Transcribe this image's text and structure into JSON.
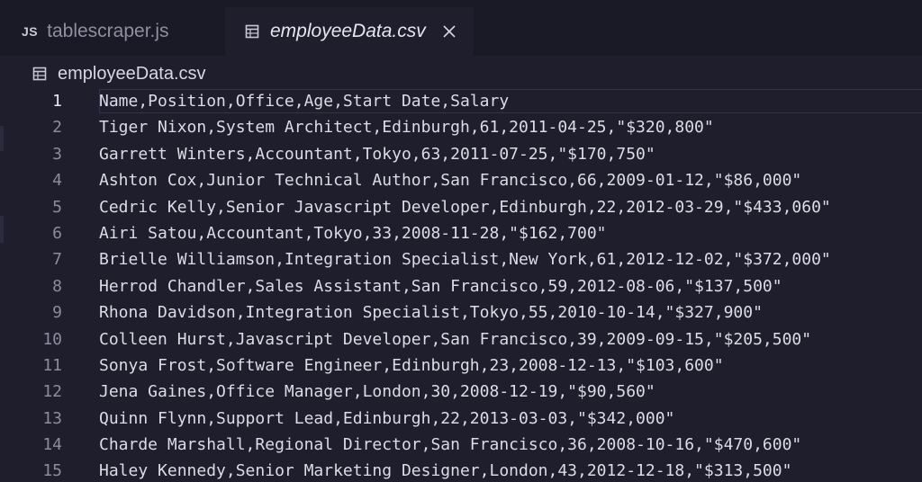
{
  "tabs": [
    {
      "icon": "JS",
      "label": "tablescraper.js",
      "active": false
    },
    {
      "icon": "csv-file-icon",
      "label": "employeeData.csv",
      "active": true
    }
  ],
  "breadcrumb": {
    "icon": "csv-file-icon",
    "label": "employeeData.csv"
  },
  "editor": {
    "current_line": 1,
    "lines": [
      {
        "number": "1",
        "text": "Name,Position,Office,Age,Start Date,Salary"
      },
      {
        "number": "2",
        "text": "Tiger Nixon,System Architect,Edinburgh,61,2011-04-25,\"$320,800\""
      },
      {
        "number": "3",
        "text": "Garrett Winters,Accountant,Tokyo,63,2011-07-25,\"$170,750\""
      },
      {
        "number": "4",
        "text": "Ashton Cox,Junior Technical Author,San Francisco,66,2009-01-12,\"$86,000\""
      },
      {
        "number": "5",
        "text": "Cedric Kelly,Senior Javascript Developer,Edinburgh,22,2012-03-29,\"$433,060\""
      },
      {
        "number": "6",
        "text": "Airi Satou,Accountant,Tokyo,33,2008-11-28,\"$162,700\""
      },
      {
        "number": "7",
        "text": "Brielle Williamson,Integration Specialist,New York,61,2012-12-02,\"$372,000\""
      },
      {
        "number": "8",
        "text": "Herrod Chandler,Sales Assistant,San Francisco,59,2012-08-06,\"$137,500\""
      },
      {
        "number": "9",
        "text": "Rhona Davidson,Integration Specialist,Tokyo,55,2010-10-14,\"$327,900\""
      },
      {
        "number": "10",
        "text": "Colleen Hurst,Javascript Developer,San Francisco,39,2009-09-15,\"$205,500\""
      },
      {
        "number": "11",
        "text": "Sonya Frost,Software Engineer,Edinburgh,23,2008-12-13,\"$103,600\""
      },
      {
        "number": "12",
        "text": "Jena Gaines,Office Manager,London,30,2008-12-19,\"$90,560\""
      },
      {
        "number": "13",
        "text": "Quinn Flynn,Support Lead,Edinburgh,22,2013-03-03,\"$342,000\""
      },
      {
        "number": "14",
        "text": "Charde Marshall,Regional Director,San Francisco,36,2008-10-16,\"$470,600\""
      },
      {
        "number": "15",
        "text": "Haley Kennedy,Senior Marketing Designer,London,43,2012-12-18,\"$313,500\""
      }
    ]
  },
  "colors": {
    "background": "#1f1e2c",
    "tabbar": "#1a1926",
    "line_number": "#8c8c9e",
    "text": "#dcdce6"
  }
}
